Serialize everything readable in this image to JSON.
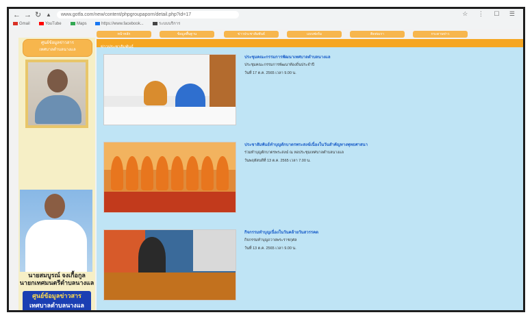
{
  "browser": {
    "url": "www.gotfa.com/new/content/phpgroupaporn/detail.php?id=17",
    "back_icon": "back-arrow-icon",
    "forward_icon": "forward-arrow-icon",
    "reload_icon": "reload-icon",
    "bookmarks": [
      {
        "label": "Gmail",
        "color": "#d93025"
      },
      {
        "label": "YouTube",
        "color": "#ff0000"
      },
      {
        "label": "Maps",
        "color": "#34a853"
      },
      {
        "label": "https://www.facebook...",
        "color": "#1877f2"
      },
      {
        "label": "ระบบบริการ",
        "color": "#444444"
      }
    ]
  },
  "nav": {
    "items": [
      "หน้าหลัก",
      "ข้อมูลพื้นฐาน",
      "ข่าวประชาสัมพันธ์",
      "แบบฟอร์ม",
      "ติดต่อเรา",
      "กระดานข่าว"
    ],
    "accent": "#f7b64d"
  },
  "sidebar": {
    "logo_line1": "ศูนย์ข้อมูลข่าวสาร",
    "logo_line2": "เทศบาลตำบลนางแล",
    "mayor_caption_line1": "นายสมบูรณ์ จงเกื้อกูล",
    "mayor_caption_line2": "นายกเทศมนตรีตำบลนางแล",
    "banner_line1": "ศูนย์ข้อมูลข่าวสาร",
    "banner_line2": "เทศบาลตำบลนางแล"
  },
  "main": {
    "section_title": "ข่าวประชาสัมพันธ์",
    "section_color": "#f5a623",
    "background": "#bfe4f5",
    "news": [
      {
        "title": "ประชุมคณะกรรมการพัฒนาเทศบาลตำบลนางแล",
        "desc": "ประชุมคณะกรรมการพัฒนาท้องถิ่นประจำปี",
        "date": "วันที่ 17 ต.ค. 2565 เวลา 9.00 น."
      },
      {
        "title": "ประชาสัมพันธ์ทำบุญตักบาตรพระสงฆ์เนื่องในวันสำคัญทางพุทธศาสนา",
        "desc": "ร่วมทำบุญตักบาตรพระสงฆ์ ณ หอประชุมเทศบาลตำบลนางแล",
        "date": "วันพฤหัสบดีที่ 13 ต.ค. 2565 เวลา 7.00 น."
      },
      {
        "title": "กิจกรรมทำบุญเนื่องในวันคล้ายวันสวรรคต",
        "desc": "กิจกรรมทำบุญถวายพระราชกุศล",
        "date": "วันที่ 13 ต.ค. 2565 เวลา 9.00 น."
      }
    ]
  }
}
